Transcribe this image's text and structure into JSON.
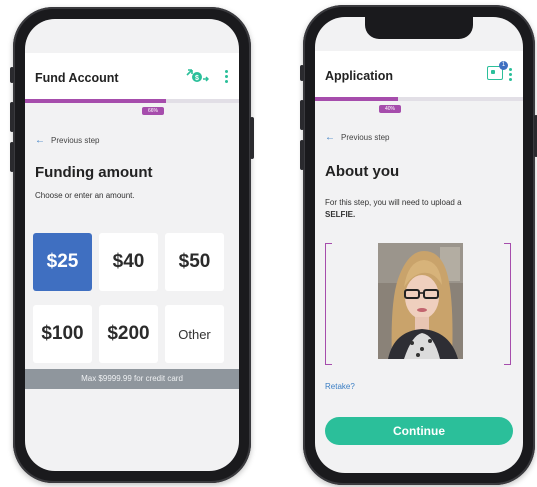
{
  "left_screen": {
    "title": "Fund Account",
    "progress_label": "66%",
    "progress_fraction": 0.66,
    "previous_step": "Previous step",
    "heading": "Funding amount",
    "subtitle": "Choose or enter an amount.",
    "amounts": [
      "$25",
      "$40",
      "$50",
      "$100",
      "$200",
      "Other"
    ],
    "selected_amount": "$25",
    "max_note": "Max $9999.99 for credit card",
    "icons": [
      "add-funds-icon",
      "more-options-icon"
    ]
  },
  "right_screen": {
    "title": "Application",
    "notification_count": "1",
    "progress_label": "40%",
    "progress_fraction": 0.4,
    "previous_step": "Previous step",
    "heading": "About you",
    "instruction_text": "For this step, you will need to upload a",
    "instruction_bold": "SELFIE.",
    "retake": "Retake?",
    "continue": "Continue",
    "icons": [
      "notification-icon",
      "more-options-icon"
    ]
  },
  "colors": {
    "accent_purple": "#a64dac",
    "accent_teal": "#2bbf9a",
    "selected_blue": "#3f6fc1",
    "link_blue": "#3a7ec4"
  }
}
